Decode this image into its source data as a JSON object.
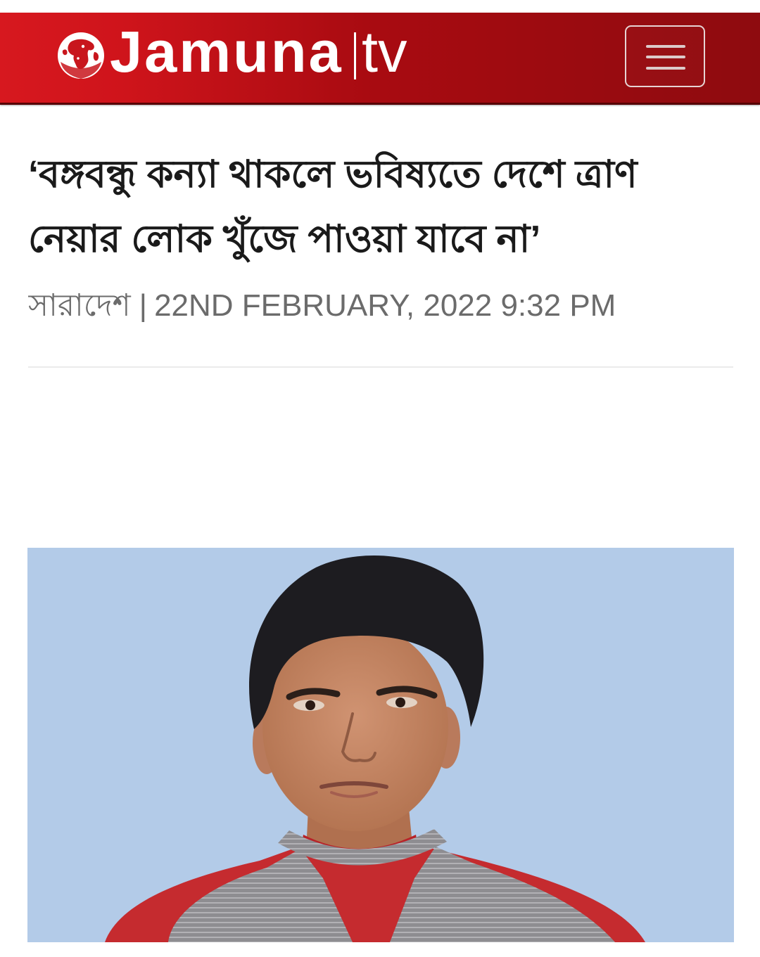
{
  "header": {
    "logo_icon": "globe-icon",
    "logo_name": "Jamuna",
    "logo_suffix": "tv",
    "menu_icon": "hamburger-icon"
  },
  "article": {
    "title_lines": [
      "‘বঙ্গবন্ধু কন্যা থাকলে ভবিষ্যতে দেশে ত্রাণ",
      "নেয়ার লোক খুঁজে পাওয়া যাবে না’"
    ],
    "category": "সারাদেশ",
    "meta_separator": "|",
    "published": "22ND FEBRUARY, 2022 9:32 PM"
  },
  "colors": {
    "header_red_light": "#d7181f",
    "header_red_dark": "#8e0b0f",
    "title_text": "#1a1a1a",
    "meta_text": "#6b6b6b",
    "photo_background": "#b3cbe8"
  }
}
